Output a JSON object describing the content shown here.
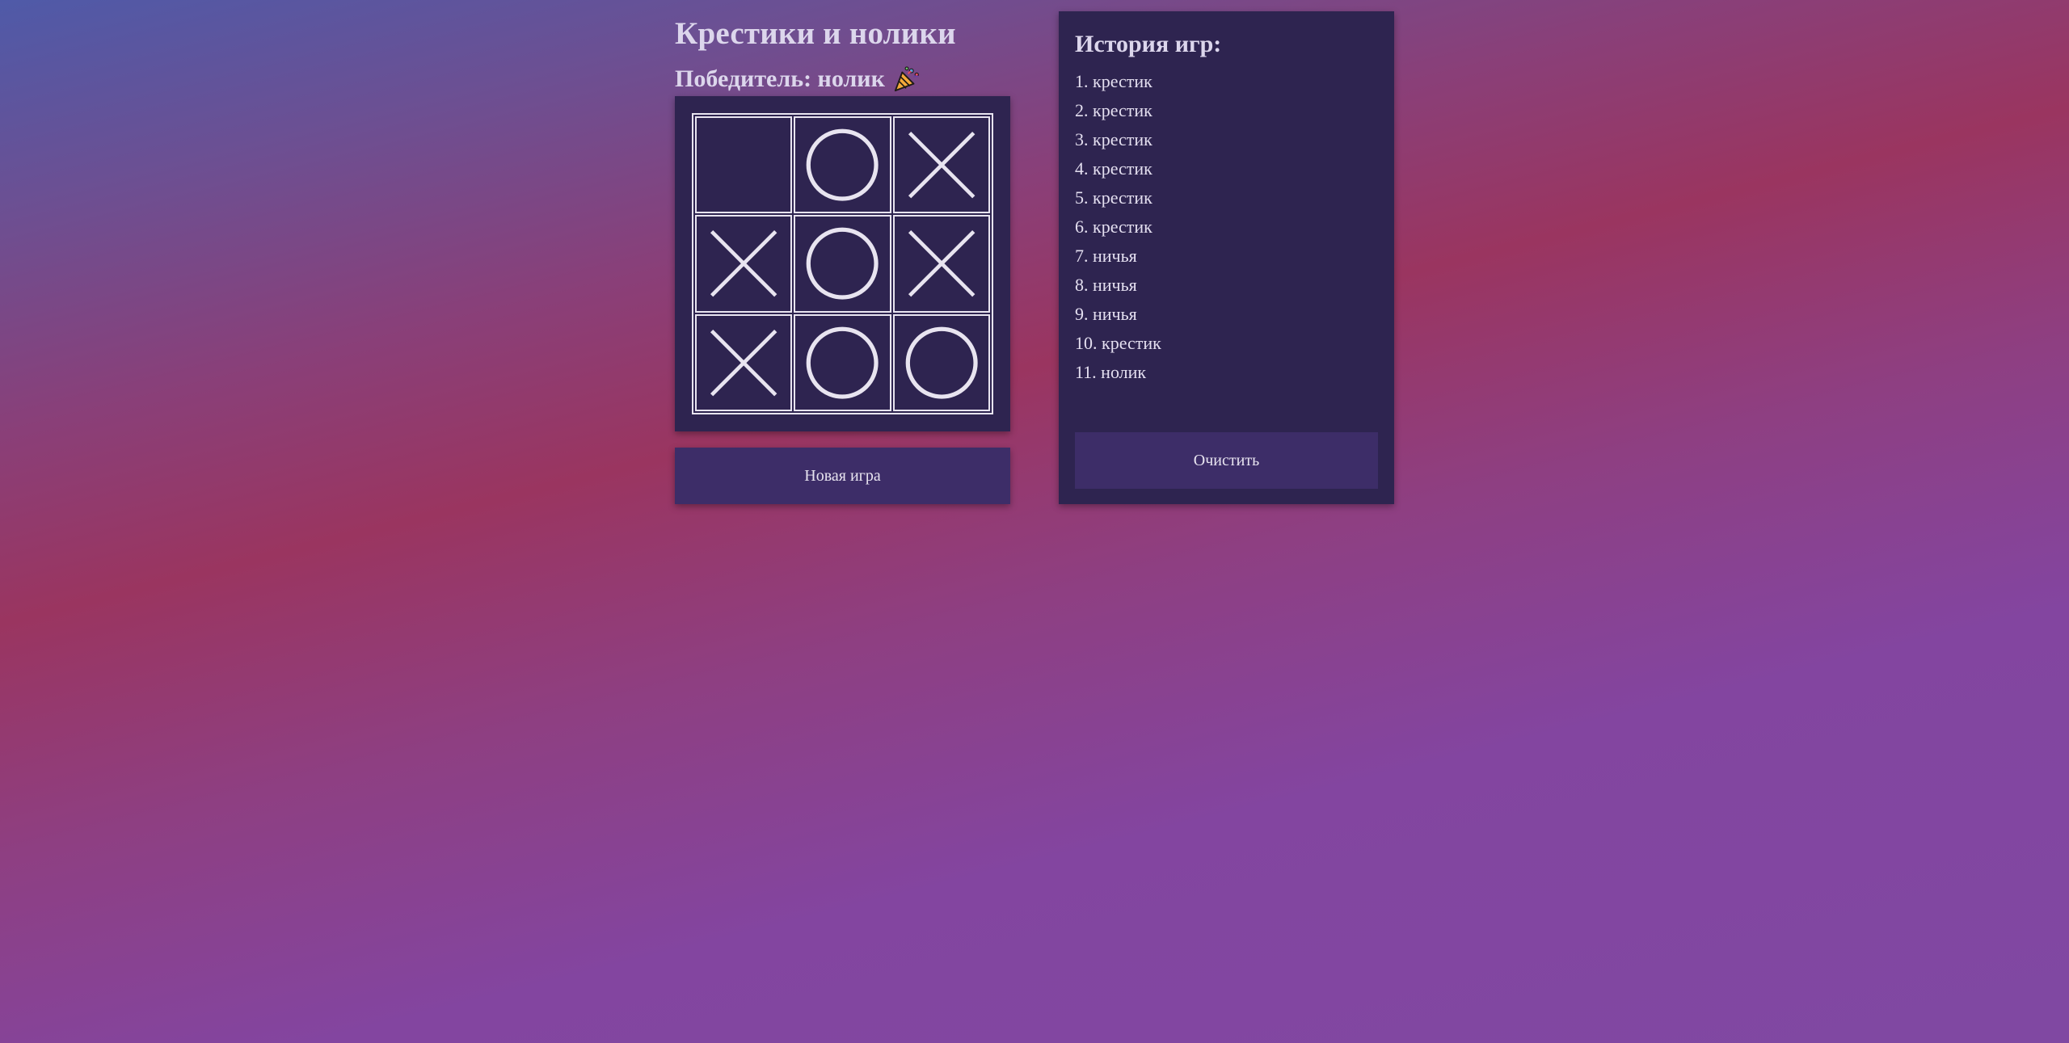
{
  "game": {
    "title": "Крестики и нолики",
    "winner_label": "Победитель: нолик",
    "winner_icon": "party-popper-icon",
    "board": [
      "",
      "O",
      "X",
      "X",
      "O",
      "X",
      "X",
      "O",
      "O"
    ],
    "new_game_label": "Новая игра"
  },
  "history": {
    "title": "История игр:",
    "items": [
      "1. крестик",
      "2. крестик",
      "3. крестик",
      "4. крестик",
      "5. крестик",
      "6. крестик",
      "7. ничья",
      "8. ничья",
      "9. ничья",
      "10. крестик",
      "11. нолик"
    ],
    "clear_label": "Очистить"
  },
  "colors": {
    "panel": "#2e2450",
    "button": "#3d2d68",
    "mark": "#e8e4f0"
  }
}
